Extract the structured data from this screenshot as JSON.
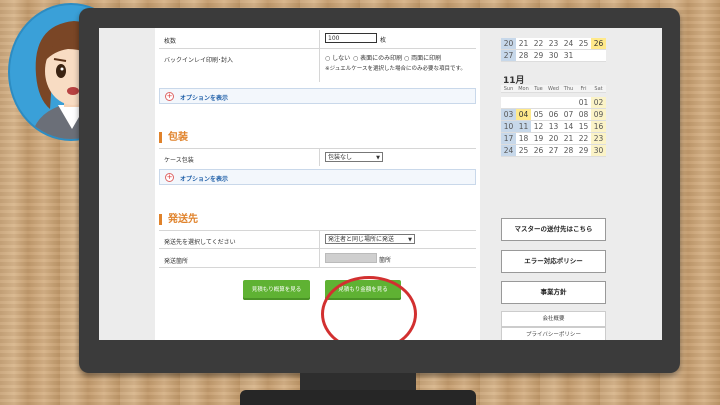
{
  "options": {
    "qty_label": "枚数",
    "qty_value": "100",
    "qty_unit": "枚",
    "backinlay_label": "バックインレイ印刷･封入",
    "radio_none": "しない",
    "radio_front": "表面にのみ印刷",
    "radio_both": "両面に印刷",
    "note": "※ジュエルケースを選択した場合にのみ必要な項目です。",
    "show_options": "オプションを表示"
  },
  "packaging": {
    "title": "包装",
    "case_label": "ケース包装",
    "case_value": "包装なし",
    "show_options": "オプションを表示"
  },
  "shipping": {
    "title": "発送先",
    "select_label": "発送先を選択してください",
    "select_value": "発注者と同じ場所に発送",
    "count_label": "発送箇所",
    "count_unit": "箇所"
  },
  "buttons": {
    "details": "見積もり概算を見る",
    "amount": "見積もり金額を見る"
  },
  "calendar": {
    "oct_rows": [
      [
        "20",
        "21",
        "22",
        "23",
        "24",
        "25",
        "26"
      ],
      [
        "27",
        "28",
        "29",
        "30",
        "31",
        "",
        ""
      ]
    ],
    "nov_title": "11月",
    "weekdays": [
      "Sun",
      "Mon",
      "Tue",
      "Wed",
      "Thu",
      "Fri",
      "Sat"
    ],
    "nov_rows": [
      [
        "",
        "",
        "",
        "",
        "",
        "01",
        "02"
      ],
      [
        "03",
        "04",
        "05",
        "06",
        "07",
        "08",
        "09"
      ],
      [
        "10",
        "11",
        "12",
        "13",
        "14",
        "15",
        "16"
      ],
      [
        "17",
        "18",
        "19",
        "20",
        "21",
        "22",
        "23"
      ],
      [
        "24",
        "25",
        "26",
        "27",
        "28",
        "29",
        "30"
      ]
    ]
  },
  "sidebar": {
    "master": "マスターの送付先はこちら",
    "error_policy": "エラー対応ポリシー",
    "policy": "事業方針",
    "company": "会社概要",
    "privacy": "プライバシーポリシー"
  },
  "colors": {
    "accent": "#e0822a",
    "button_green": "#5fb233",
    "highlight_circle": "#d23030"
  }
}
